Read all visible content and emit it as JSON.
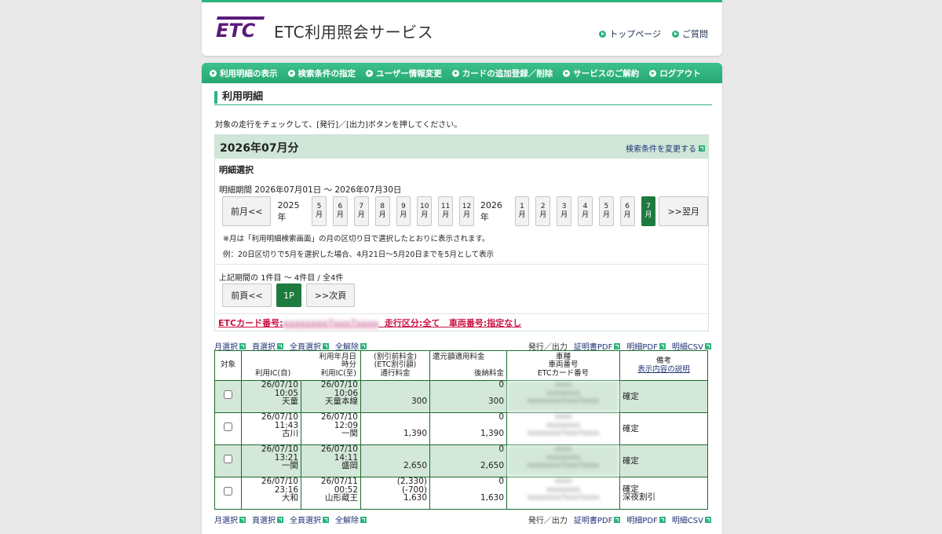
{
  "header": {
    "logo_text": "ETC",
    "site_title": "ETC利用照会サービス",
    "links": [
      "トップページ",
      "ご質問"
    ]
  },
  "nav": [
    "利用明細の表示",
    "検索条件の指定",
    "ユーザー情報変更",
    "カードの追加登録／削除",
    "サービスのご解約",
    "ログアウト"
  ],
  "page": {
    "title": "利用明細",
    "instruction": "対象の走行をチェックして、[発行]／[出力]ボタンを押してください。"
  },
  "selection": {
    "month_label": "2026年07月分",
    "change_link": "検索条件を変更する",
    "subheading": "明細選択",
    "period": "明細期間 2026年07月01日 ～ 2026年07月30日",
    "prev_label": "前月<<",
    "next_label": ">>翌月",
    "year1": "2025年",
    "year2": "2026年",
    "months_2025": [
      "5",
      "6",
      "7",
      "8",
      "9",
      "10",
      "11",
      "12"
    ],
    "months_2026": [
      "1",
      "2",
      "3",
      "4",
      "5",
      "6",
      "7"
    ],
    "month_suffix": "月",
    "note1": "※月は「利用明細検索画面」の月の区切り日で選択したとおりに表示されます。",
    "note2": "例：20日区切りで5月を選択した場合、4月21日～5月20日までを5月として表示",
    "range": "上記期間の 1件目 ～ 4件目 / 全4件",
    "prev_page": "前頁<<",
    "page_num": "1P",
    "next_page": ">>次頁",
    "card_label": "ETCカード番号:",
    "card_masked": "xxxxxxxx7xxx7xxxx",
    "run_filter": "走行区分:全て",
    "vehicle_filter": "車両番号:指定なし"
  },
  "actions": {
    "left": [
      "月選択",
      "頁選択",
      "全頁選択",
      "全解除"
    ],
    "issue": "発行／出力",
    "right": [
      "証明書PDF",
      "明細PDF",
      "明細CSV"
    ]
  },
  "table": {
    "headers": {
      "target": "対象",
      "date_line1": "利用年月日",
      "date_line2": "時分",
      "ic_from": "利用IC(自)",
      "ic_to": "利用IC(至)",
      "fee_line1": "(割引前料金)",
      "fee_line2": "(ETC割引額)",
      "fee_line3": "通行料金",
      "refund_line1": "還元額適用料金",
      "refund_line2": "後納料金",
      "vehicle_line1": "車種",
      "vehicle_line2": "車両番号",
      "vehicle_line3": "ETCカード番号",
      "remarks": "備考",
      "remarks_link": "表示内容の説明"
    },
    "rows": [
      {
        "from_date": "26/07/10",
        "from_time": "10:05",
        "from_ic": "天童",
        "to_date": "26/07/10",
        "to_time": "10:06",
        "to_ic": "天童本線",
        "fee_pre": "",
        "fee_disc": "",
        "fee": "300",
        "refund": "0",
        "deferred": "300",
        "vehicle1": "xxxx",
        "vehicle2": "xxxxxxxx",
        "vehicle3": "xxxxxxxx7xxx7xxxx",
        "remark1": "確定",
        "remark2": ""
      },
      {
        "from_date": "26/07/10",
        "from_time": "11:43",
        "from_ic": "古川",
        "to_date": "26/07/10",
        "to_time": "12:09",
        "to_ic": "一関",
        "fee_pre": "",
        "fee_disc": "",
        "fee": "1,390",
        "refund": "0",
        "deferred": "1,390",
        "vehicle1": "xxxx",
        "vehicle2": "xxxxxxxx",
        "vehicle3": "xxxxxxxx7xxx7xxxx",
        "remark1": "確定",
        "remark2": ""
      },
      {
        "from_date": "26/07/10",
        "from_time": "13:21",
        "from_ic": "一関",
        "to_date": "26/07/10",
        "to_time": "14:11",
        "to_ic": "盛岡",
        "fee_pre": "",
        "fee_disc": "",
        "fee": "2,650",
        "refund": "0",
        "deferred": "2,650",
        "vehicle1": "xxxx",
        "vehicle2": "xxxxxxxx",
        "vehicle3": "xxxxxxxx7xxx7xxxx",
        "remark1": "確定",
        "remark2": ""
      },
      {
        "from_date": "26/07/10",
        "from_time": "23:16",
        "from_ic": "大和",
        "to_date": "26/07/11",
        "to_time": "00:52",
        "to_ic": "山形蔵王",
        "fee_pre": "(2,330)",
        "fee_disc": "(-700)",
        "fee": "1,630",
        "refund": "0",
        "deferred": "1,630",
        "vehicle1": "xxxx",
        "vehicle2": "xxxxxxxx",
        "vehicle3": "xxxxxxxx7xxx7xxxx",
        "remark1": "確定",
        "remark2": "深夜割引"
      }
    ]
  },
  "colors": {
    "accent": "#2fb37e",
    "active": "#1f7a3f",
    "row_highlight": "#d3e8d9",
    "logo": "#5a1a7a",
    "alert": "#cc1144"
  }
}
